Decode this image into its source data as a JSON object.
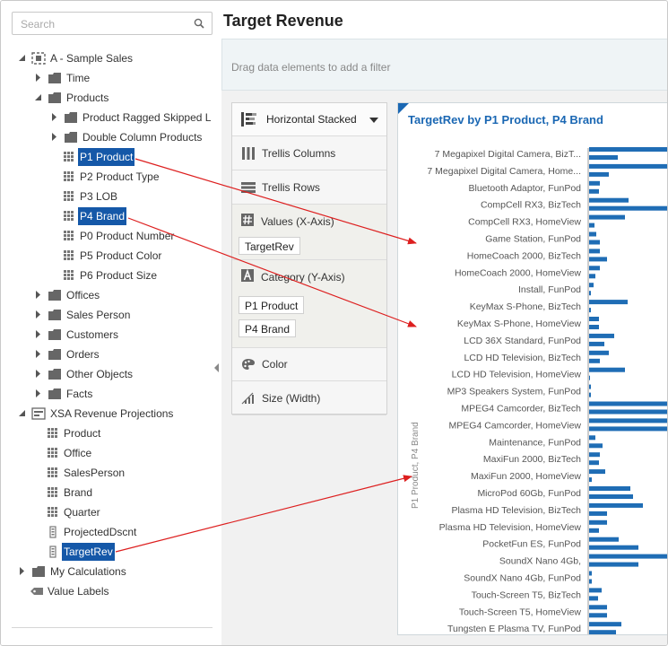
{
  "search": {
    "placeholder": "Search",
    "value": ""
  },
  "tree": {
    "sample_sales": "A - Sample Sales",
    "time": "Time",
    "products": "Products",
    "product_ragged": "Product Ragged Skipped L",
    "double_column": "Double Column Products",
    "p1_product": "P1 Product",
    "p2_product_type": "P2 Product Type",
    "p3_lob": "P3 LOB",
    "p4_brand": "P4 Brand",
    "p0_product_number": "P0 Product Number",
    "p5_product_color": "P5 Product Color",
    "p6_product_size": "P6 Product Size",
    "offices": "Offices",
    "sales_person": "Sales Person",
    "customers": "Customers",
    "orders": "Orders",
    "other_objects": "Other Objects",
    "facts": "Facts",
    "xsa_revenue": "XSA Revenue Projections",
    "x_product": "Product",
    "x_office": "Office",
    "x_salesperson": "SalesPerson",
    "x_brand": "Brand",
    "x_quarter": "Quarter",
    "x_projected": "ProjectedDscnt",
    "x_targetrev": "TargetRev",
    "my_calculations": "My Calculations",
    "value_labels": "Value Labels"
  },
  "header": {
    "title": "Target Revenue"
  },
  "filter_bar": {
    "hint": "Drag data elements to add a filter"
  },
  "grammar": {
    "chart_type": "Horizontal Stacked",
    "trellis_columns": "Trellis Columns",
    "trellis_rows": "Trellis Rows",
    "values_title": "Values (X-Axis)",
    "values_items": [
      "TargetRev"
    ],
    "category_title": "Category (Y-Axis)",
    "category_items": [
      "P1 Product",
      "P4 Brand"
    ],
    "color": "Color",
    "size": "Size (Width)"
  },
  "colors": {
    "accent": "#1a67b3",
    "selection": "#1558a8",
    "bar": "#1f6db5",
    "arrow": "#dd1f1f"
  },
  "chart_data": {
    "type": "bar",
    "orientation": "horizontal",
    "title": "TargetRev by P1 Product, P4 Brand",
    "ylabel": "P1 Product, P4 Brand",
    "categories": [
      "7 Megapixel Digital Camera, BizT...",
      "7 Megapixel Digital Camera, Home...",
      "Bluetooth Adaptor, FunPod",
      "CompCell RX3, BizTech",
      "CompCell RX3, HomeView",
      "Game Station, FunPod",
      "HomeCoach 2000, BizTech",
      "HomeCoach 2000, HomeView",
      "Install, FunPod",
      "KeyMax S-Phone, BizTech",
      "KeyMax S-Phone, HomeView",
      "LCD 36X Standard, FunPod",
      "LCD HD Television, BizTech",
      "LCD HD Television, HomeView",
      "MP3 Speakers System, FunPod",
      "MPEG4 Camcorder, BizTech",
      "MPEG4 Camcorder, HomeView",
      "Maintenance, FunPod",
      "MaxiFun 2000, BizTech",
      "MaxiFun 2000, HomeView",
      "MicroPod 60Gb, FunPod",
      "Plasma HD Television, BizTech",
      "Plasma HD Television, HomeView",
      "PocketFun ES, FunPod",
      "SoundX Nano 4Gb,",
      "SoundX Nano 4Gb, FunPod",
      "Touch-Screen T5, BizTech",
      "Touch-Screen T5, HomeView",
      "Tungsten E Plasma TV, FunPod"
    ],
    "series": [
      {
        "values": [
          90,
          32
        ]
      },
      {
        "values": [
          90,
          22
        ]
      },
      {
        "values": [
          12,
          11
        ]
      },
      {
        "values": [
          44,
          90
        ]
      },
      {
        "values": [
          40,
          6
        ]
      },
      {
        "values": [
          8,
          12
        ]
      },
      {
        "values": [
          12,
          20
        ]
      },
      {
        "values": [
          12,
          7
        ]
      },
      {
        "values": [
          5,
          2
        ]
      },
      {
        "values": [
          43,
          2
        ]
      },
      {
        "values": [
          11,
          11
        ]
      },
      {
        "values": [
          28,
          17
        ]
      },
      {
        "values": [
          22,
          12
        ]
      },
      {
        "values": [
          40,
          1
        ]
      },
      {
        "values": [
          2,
          2
        ]
      },
      {
        "values": [
          90,
          90
        ]
      },
      {
        "values": [
          90,
          90
        ]
      },
      {
        "values": [
          7,
          15
        ]
      },
      {
        "values": [
          12,
          11
        ]
      },
      {
        "values": [
          18,
          3
        ]
      },
      {
        "values": [
          46,
          49
        ]
      },
      {
        "values": [
          60,
          20
        ]
      },
      {
        "values": [
          20,
          11
        ]
      },
      {
        "values": [
          33,
          55
        ]
      },
      {
        "values": [
          90,
          55
        ]
      },
      {
        "values": [
          3,
          3
        ]
      },
      {
        "values": [
          14,
          10
        ]
      },
      {
        "values": [
          20,
          20
        ]
      },
      {
        "values": [
          36,
          30
        ]
      }
    ]
  }
}
